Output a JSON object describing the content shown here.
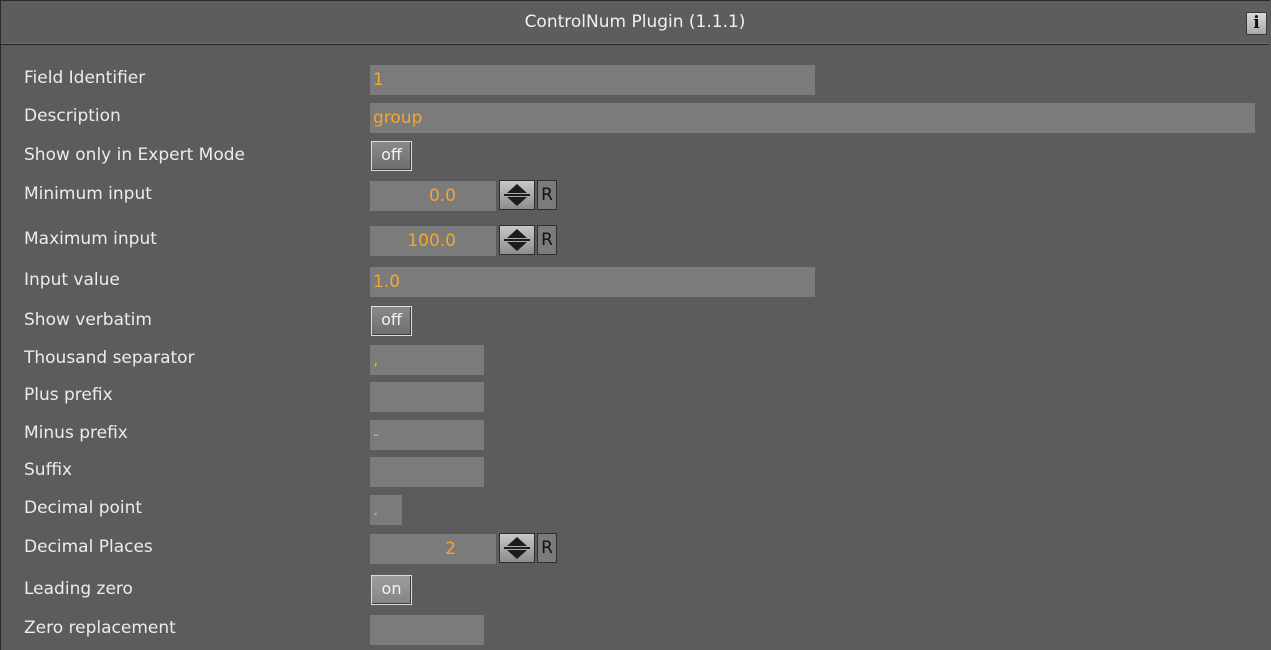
{
  "window": {
    "title": "ControlNum Plugin (1.1.1)",
    "info_icon": "i"
  },
  "fields": {
    "field_identifier": {
      "label": "Field Identifier",
      "value": "1"
    },
    "description": {
      "label": "Description",
      "value": "group"
    },
    "show_expert": {
      "label": "Show only in Expert Mode",
      "value": "off"
    },
    "minimum_input": {
      "label": "Minimum input",
      "value": "0.0",
      "reset": "R"
    },
    "maximum_input": {
      "label": "Maximum input",
      "value": "100.0",
      "reset": "R"
    },
    "input_value": {
      "label": "Input value",
      "value": "1.0"
    },
    "show_verbatim": {
      "label": "Show verbatim",
      "value": "off"
    },
    "thousand_separator": {
      "label": "Thousand separator",
      "value": ","
    },
    "plus_prefix": {
      "label": "Plus prefix",
      "value": ""
    },
    "minus_prefix": {
      "label": "Minus prefix",
      "value": "-"
    },
    "suffix": {
      "label": "Suffix",
      "value": ""
    },
    "decimal_point": {
      "label": "Decimal point",
      "value": "."
    },
    "decimal_places": {
      "label": "Decimal Places",
      "value": "2",
      "reset": "R"
    },
    "leading_zero": {
      "label": "Leading zero",
      "value": "on"
    },
    "zero_replacement": {
      "label": "Zero replacement",
      "value": ""
    }
  }
}
